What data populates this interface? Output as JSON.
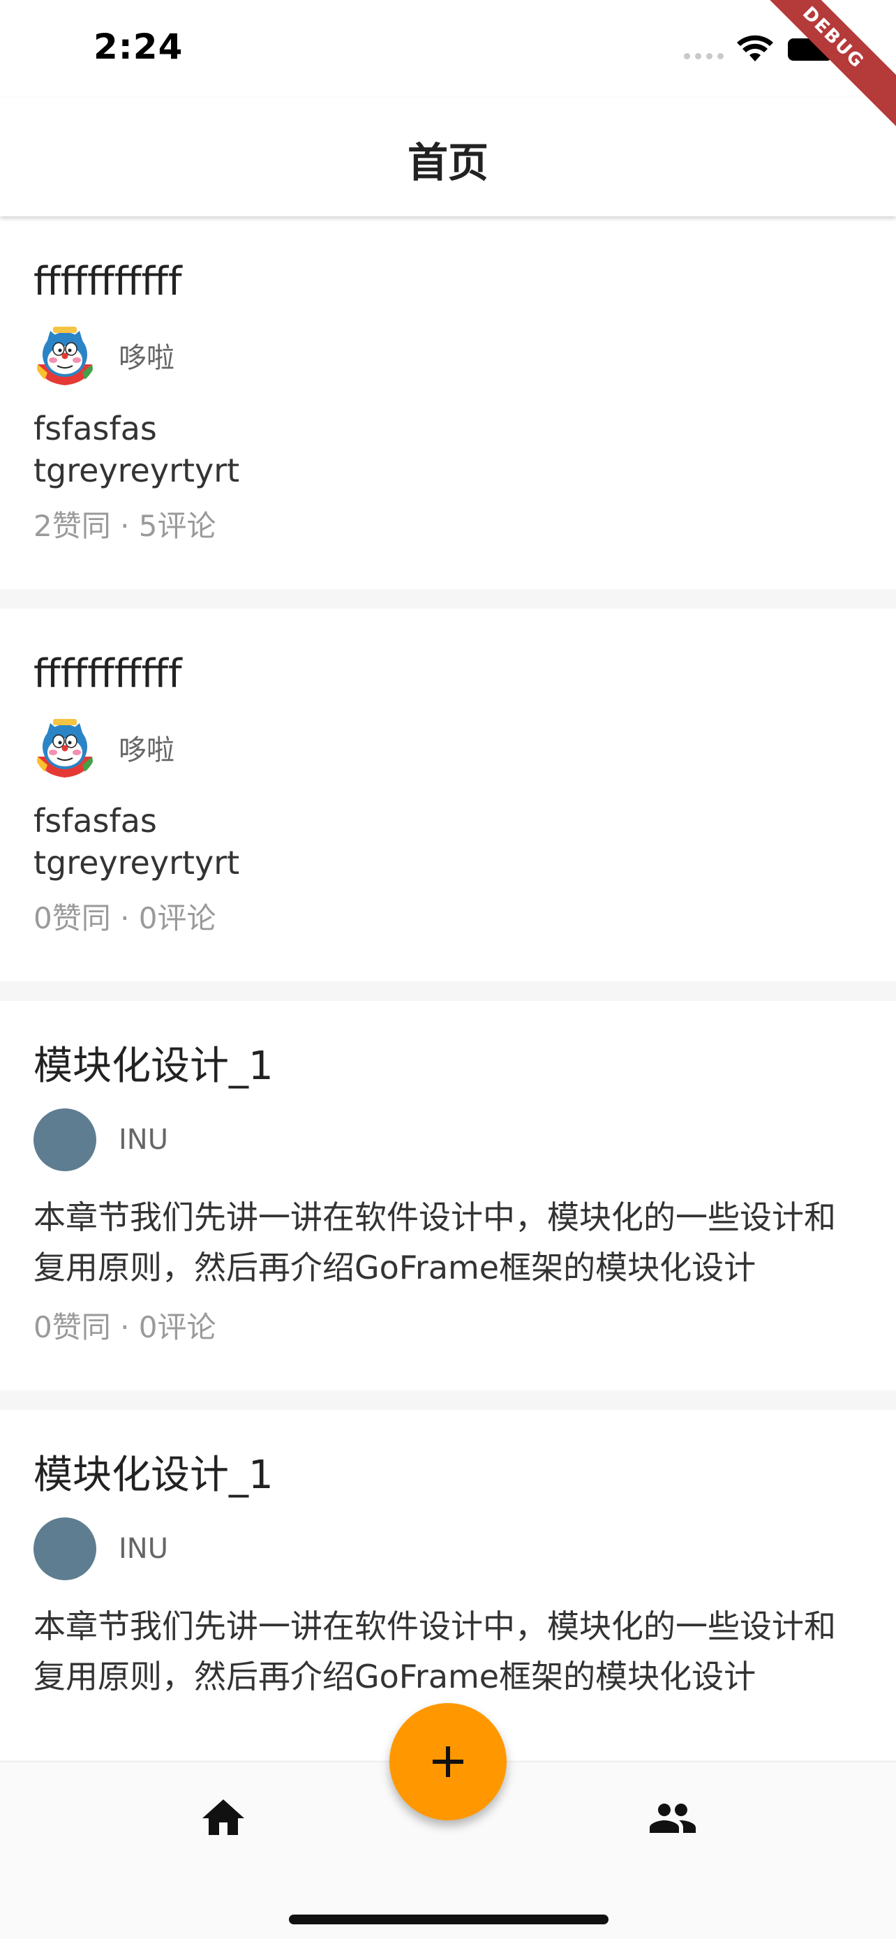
{
  "status_bar": {
    "time": "2:24",
    "debug_label": "DEBUG"
  },
  "app_bar": {
    "title": "首页"
  },
  "posts": [
    {
      "title": "fffffffffff",
      "author": "哆啦",
      "avatar": "doraemon-avatar",
      "body_lines": [
        "fsfasfas",
        "tgreyreyrtyrt"
      ],
      "stats": "2赞同 · 5评论"
    },
    {
      "title": "fffffffffff",
      "author": "哆啦",
      "avatar": "doraemon-avatar",
      "body_lines": [
        "fsfasfas",
        "tgreyreyrtyrt"
      ],
      "stats": "0赞同 · 0评论"
    },
    {
      "title": "模块化设计_1",
      "author": "INU",
      "avatar": "plain-avatar",
      "body": "本章节我们先讲一讲在软件设计中，模块化的一些设计和复用原则，然后再介绍GoFrame框架的模块化设计",
      "stats": "0赞同 · 0评论"
    },
    {
      "title": "模块化设计_1",
      "author": "INU",
      "avatar": "plain-avatar",
      "body": "本章节我们先讲一讲在软件设计中，模块化的一些设计和复用原则，然后再介绍GoFrame框架的模块化设计",
      "stats": ""
    }
  ],
  "fab": {
    "icon": "plus-icon"
  },
  "bottom_nav": {
    "items": [
      {
        "icon": "home-icon"
      },
      {
        "icon": "people-icon"
      }
    ]
  },
  "colors": {
    "accent": "#ff9800",
    "avatar_plain": "#5e7d90",
    "debug_banner": "#b53a3a"
  }
}
